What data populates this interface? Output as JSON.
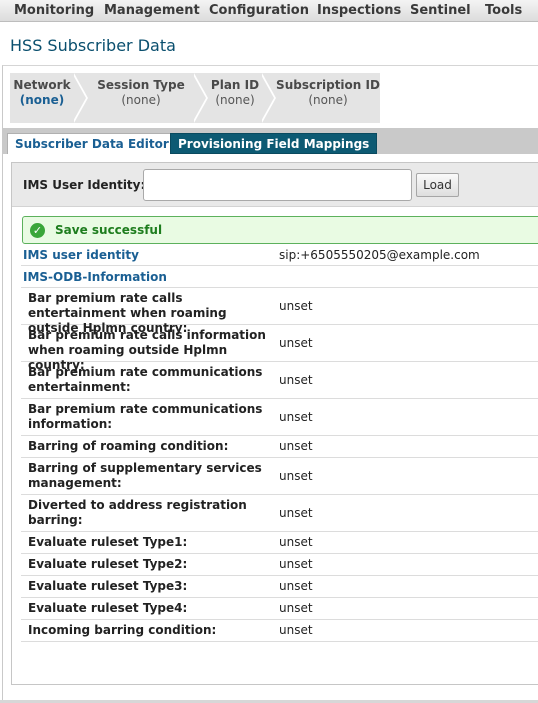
{
  "menu": [
    "Monitoring",
    "Management",
    "Configuration",
    "Inspections",
    "Sentinel",
    "Tools"
  ],
  "page_title": "HSS Subscriber Data",
  "breadcrumb": [
    {
      "title": "Network",
      "value": "(none)"
    },
    {
      "title": "Session Type",
      "value": "(none)"
    },
    {
      "title": "Plan ID",
      "value": "(none)"
    },
    {
      "title": "Subscription ID",
      "value": "(none)"
    }
  ],
  "tabs": {
    "active": "Subscriber Data Editor",
    "inactive": "Provisioning Field Mappings"
  },
  "search": {
    "label": "IMS User Identity:",
    "value": "",
    "placeholder": "",
    "button": "Load"
  },
  "status": {
    "message": "Save successful",
    "color": "#1e7d1e"
  },
  "identity": {
    "label": "IMS user identity",
    "value": "sip:+6505550205@example.com"
  },
  "section": "IMS-ODB-Information",
  "fields": [
    {
      "label": "Bar premium rate calls entertainment when roaming outside Hplmn country:",
      "value": "unset"
    },
    {
      "label": "Bar premium rate calls information when roaming outside Hplmn country:",
      "value": "unset"
    },
    {
      "label": "Bar premium rate communications entertainment:",
      "value": "unset"
    },
    {
      "label": "Bar premium rate communications information:",
      "value": "unset"
    },
    {
      "label": "Barring of roaming condition:",
      "value": "unset"
    },
    {
      "label": "Barring of supplementary services management:",
      "value": "unset"
    },
    {
      "label": "Diverted to address registration barring:",
      "value": "unset"
    },
    {
      "label": "Evaluate ruleset Type1:",
      "value": "unset"
    },
    {
      "label": "Evaluate ruleset Type2:",
      "value": "unset"
    },
    {
      "label": "Evaluate ruleset Type3:",
      "value": "unset"
    },
    {
      "label": "Evaluate ruleset Type4:",
      "value": "unset"
    },
    {
      "label": "Incoming barring condition:",
      "value": "unset"
    }
  ]
}
